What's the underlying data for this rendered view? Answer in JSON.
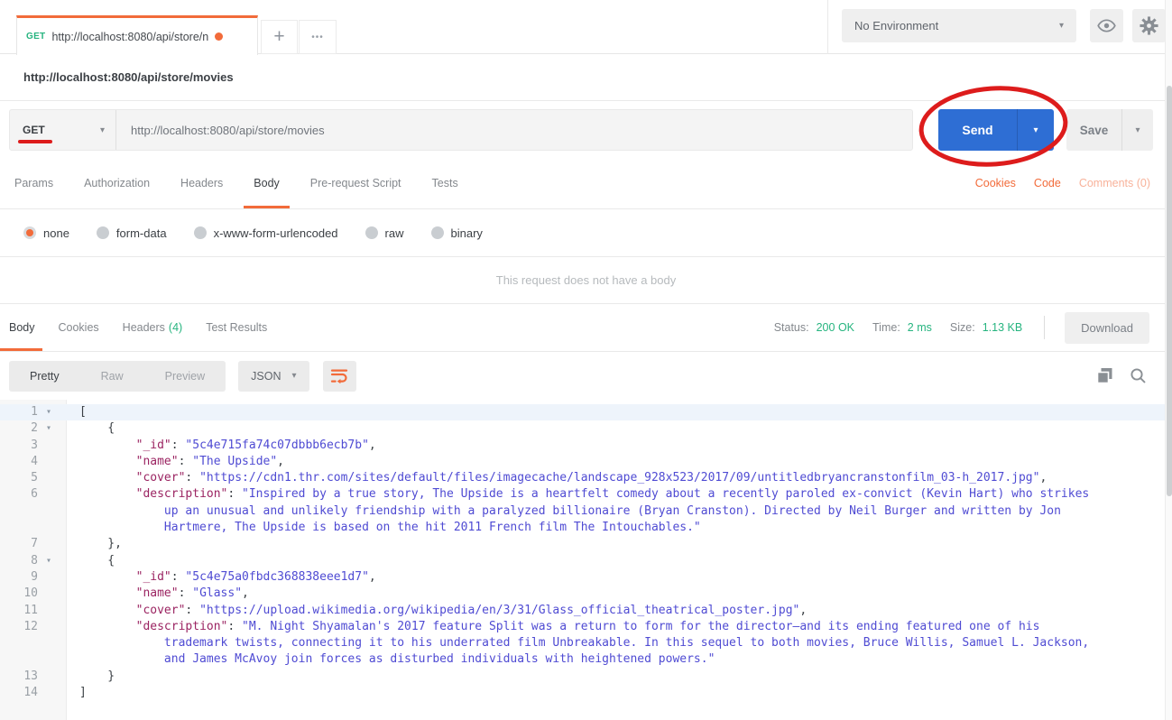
{
  "header": {
    "tab": {
      "method": "GET",
      "url": "http://localhost:8080/api/store/n",
      "unsaved_dot": "●"
    },
    "new_tab": "+",
    "tab_menu": "•••",
    "environment_selector": "No Environment"
  },
  "request": {
    "title": "http://localhost:8080/api/store/movies",
    "method": "GET",
    "url": "http://localhost:8080/api/store/movies",
    "send": "Send",
    "save": "Save",
    "tabs": {
      "params": "Params",
      "authorization": "Authorization",
      "headers": "Headers",
      "body": "Body",
      "prerequest": "Pre-request Script",
      "tests": "Tests"
    },
    "links": {
      "cookies": "Cookies",
      "code": "Code",
      "comments": "Comments (0)"
    },
    "body_types": {
      "none": "none",
      "form_data": "form-data",
      "urlencoded": "x-www-form-urlencoded",
      "raw": "raw",
      "binary": "binary"
    },
    "selected_body_type": "none",
    "empty_message": "This request does not have a body"
  },
  "response": {
    "tabs": {
      "body": "Body",
      "cookies": "Cookies",
      "headers": "Headers",
      "headers_count": "(4)",
      "tests": "Test Results"
    },
    "meta": {
      "status_label": "Status:",
      "status": "200 OK",
      "time_label": "Time:",
      "time": "2 ms",
      "size_label": "Size:",
      "size": "1.13 KB"
    },
    "download": "Download",
    "views": {
      "pretty": "Pretty",
      "raw": "Raw",
      "preview": "Preview"
    },
    "language": "JSON"
  },
  "colors": {
    "accent_orange": "#f26b3a",
    "green": "#26b47f",
    "send_blue": "#2e6ed4",
    "annotation_red": "#dd1c1c",
    "json_key": "#9b2462",
    "json_value": "#4f4bd3"
  },
  "code": {
    "rows": [
      {
        "n": "1",
        "fold": true,
        "hl": true,
        "seg": [
          [
            "p",
            "["
          ]
        ]
      },
      {
        "n": "2",
        "fold": true,
        "seg": [
          [
            "p",
            "    {"
          ]
        ]
      },
      {
        "n": "3",
        "seg": [
          [
            "p",
            "        "
          ],
          [
            "k",
            "\"_id\""
          ],
          [
            "p",
            ": "
          ],
          [
            "v",
            "\"5c4e715fa74c07dbbb6ecb7b\""
          ],
          [
            "p",
            ","
          ]
        ]
      },
      {
        "n": "4",
        "seg": [
          [
            "p",
            "        "
          ],
          [
            "k",
            "\"name\""
          ],
          [
            "p",
            ": "
          ],
          [
            "v",
            "\"The Upside\""
          ],
          [
            "p",
            ","
          ]
        ]
      },
      {
        "n": "5",
        "seg": [
          [
            "p",
            "        "
          ],
          [
            "k",
            "\"cover\""
          ],
          [
            "p",
            ": "
          ],
          [
            "v",
            "\"https://cdn1.thr.com/sites/default/files/imagecache/landscape_928x523/2017/09/untitledbryancranstonfilm_03-h_2017.jpg\""
          ],
          [
            "p",
            ","
          ]
        ]
      },
      {
        "n": "6",
        "seg": [
          [
            "p",
            "        "
          ],
          [
            "k",
            "\"description\""
          ],
          [
            "p",
            ": "
          ],
          [
            "v",
            "\"Inspired by a true story, The Upside is a heartfelt comedy about a recently paroled ex-convict (Kevin Hart) who strikes"
          ]
        ]
      },
      {
        "n": "",
        "seg": [
          [
            "v",
            "            up an unusual and unlikely friendship with a paralyzed billionaire (Bryan Cranston). Directed by Neil Burger and written by Jon"
          ]
        ]
      },
      {
        "n": "",
        "seg": [
          [
            "v",
            "            Hartmere, The Upside is based on the hit 2011 French film The Intouchables.\""
          ]
        ]
      },
      {
        "n": "7",
        "seg": [
          [
            "p",
            "    },"
          ]
        ]
      },
      {
        "n": "8",
        "fold": true,
        "seg": [
          [
            "p",
            "    {"
          ]
        ]
      },
      {
        "n": "9",
        "seg": [
          [
            "p",
            "        "
          ],
          [
            "k",
            "\"_id\""
          ],
          [
            "p",
            ": "
          ],
          [
            "v",
            "\"5c4e75a0fbdc368838eee1d7\""
          ],
          [
            "p",
            ","
          ]
        ]
      },
      {
        "n": "10",
        "seg": [
          [
            "p",
            "        "
          ],
          [
            "k",
            "\"name\""
          ],
          [
            "p",
            ": "
          ],
          [
            "v",
            "\"Glass\""
          ],
          [
            "p",
            ","
          ]
        ]
      },
      {
        "n": "11",
        "seg": [
          [
            "p",
            "        "
          ],
          [
            "k",
            "\"cover\""
          ],
          [
            "p",
            ": "
          ],
          [
            "v",
            "\"https://upload.wikimedia.org/wikipedia/en/3/31/Glass_official_theatrical_poster.jpg\""
          ],
          [
            "p",
            ","
          ]
        ]
      },
      {
        "n": "12",
        "seg": [
          [
            "p",
            "        "
          ],
          [
            "k",
            "\"description\""
          ],
          [
            "p",
            ": "
          ],
          [
            "v",
            "\"M. Night Shyamalan's 2017 feature Split was a return to form for the director—and its ending featured one of his"
          ]
        ]
      },
      {
        "n": "",
        "seg": [
          [
            "v",
            "            trademark twists, connecting it to his underrated film Unbreakable. In this sequel to both movies, Bruce Willis, Samuel L. Jackson,"
          ]
        ]
      },
      {
        "n": "",
        "seg": [
          [
            "v",
            "            and James McAvoy join forces as disturbed individuals with heightened powers.\""
          ]
        ]
      },
      {
        "n": "13",
        "seg": [
          [
            "p",
            "    }"
          ]
        ]
      },
      {
        "n": "14",
        "seg": [
          [
            "p",
            "]"
          ]
        ]
      }
    ]
  }
}
